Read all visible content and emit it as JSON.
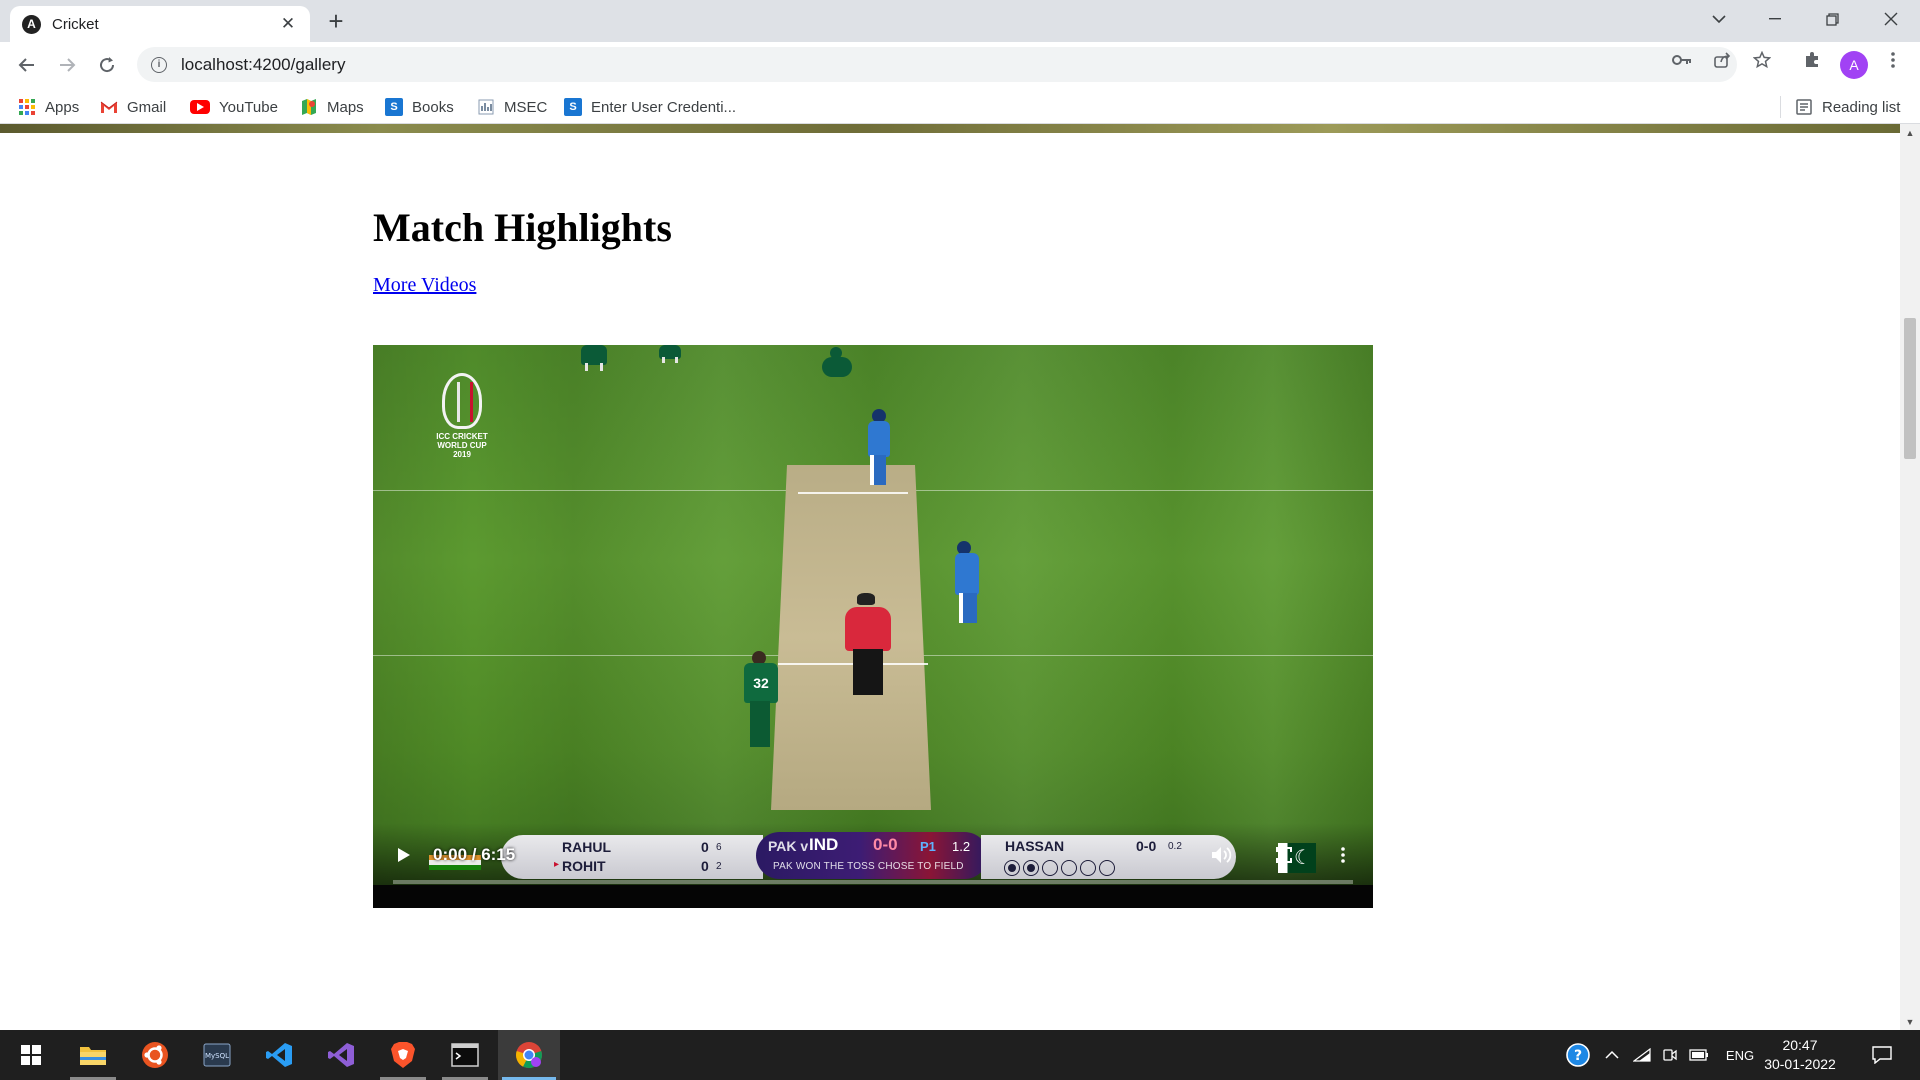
{
  "browser": {
    "tab": {
      "title": "Cricket"
    },
    "url": "localhost:4200/gallery",
    "bookmarks": [
      {
        "label": "Apps",
        "icon": "apps-grid-icon"
      },
      {
        "label": "Gmail",
        "icon": "gmail-icon"
      },
      {
        "label": "YouTube",
        "icon": "youtube-icon"
      },
      {
        "label": "Maps",
        "icon": "maps-icon"
      },
      {
        "label": "Books",
        "icon": "books-icon"
      },
      {
        "label": "MSEC",
        "icon": "msec-icon"
      },
      {
        "label": "Enter User Credenti...",
        "icon": "credentials-icon"
      }
    ],
    "reading_list": "Reading list",
    "avatar_letter": "A"
  },
  "page": {
    "title": "Match Highlights",
    "more_link": "More Videos"
  },
  "video": {
    "time": "0:00 / 6:15",
    "progress": 0,
    "logo_lines": [
      "ICC CRICKET",
      "WORLD CUP",
      "2019"
    ],
    "scoreboard": {
      "batsman1": {
        "name": "RAHUL",
        "runs": "0",
        "balls": "6"
      },
      "batsman2": {
        "name": "ROHIT",
        "runs": "0",
        "balls": "2"
      },
      "teams_a": "PAK v",
      "teams_b": "IND",
      "score": "0-0",
      "powerplay": "P1",
      "overs": "1.2",
      "toss": "PAK WON THE TOSS CHOSE TO FIELD",
      "bowler": {
        "name": "HASSAN",
        "figures": "0-0",
        "overs": "0.2"
      },
      "balls_bowled": 2,
      "balls_total": 6
    },
    "player_number": "32"
  },
  "taskbar": {
    "language": "ENG",
    "time": "20:47",
    "date": "30-01-2022"
  },
  "colors": {
    "link": "#0000ee",
    "tab_strip": "#dee1e6",
    "taskbar": "#1f1f1f",
    "avatar": "#a142f4"
  }
}
